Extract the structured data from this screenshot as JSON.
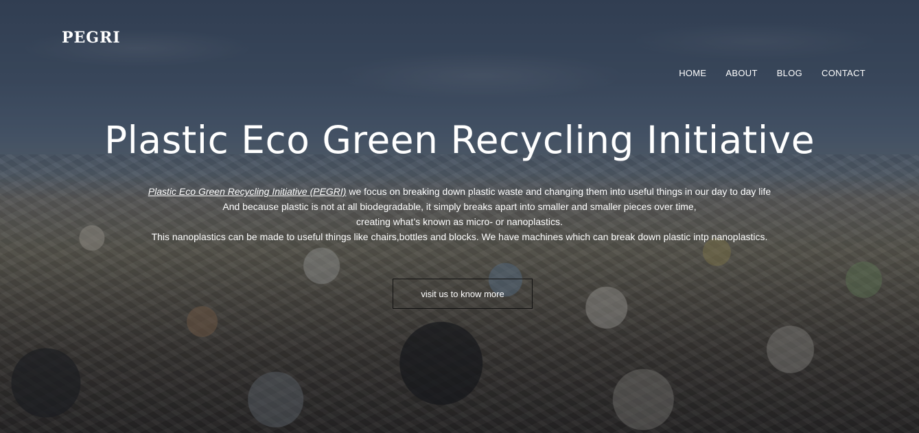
{
  "brand": {
    "logo_text": "PEGRI"
  },
  "nav": {
    "items": [
      {
        "label": "HOME"
      },
      {
        "label": "ABOUT"
      },
      {
        "label": "BLOG"
      },
      {
        "label": "CONTACT"
      }
    ]
  },
  "hero": {
    "title": "Plastic Eco Green Recycling Initiative",
    "description": {
      "link_text": "Plastic Eco Green Recycling Initiative (PEGRI)",
      "line1_rest": " we focus on breaking down plastic waste and changing them into useful things in our day to day life",
      "line2": "And because plastic is not at all biodegradable, it simply breaks apart into smaller and smaller pieces over time,",
      "line3": "creating what’s known as micro- or nanoplastics.",
      "line4": "This nanoplastics can be made to useful things like chairs,bottles and blocks. We have machines which can break down plastic intp nanoplastics."
    },
    "cta_label": "visit us to know more"
  }
}
